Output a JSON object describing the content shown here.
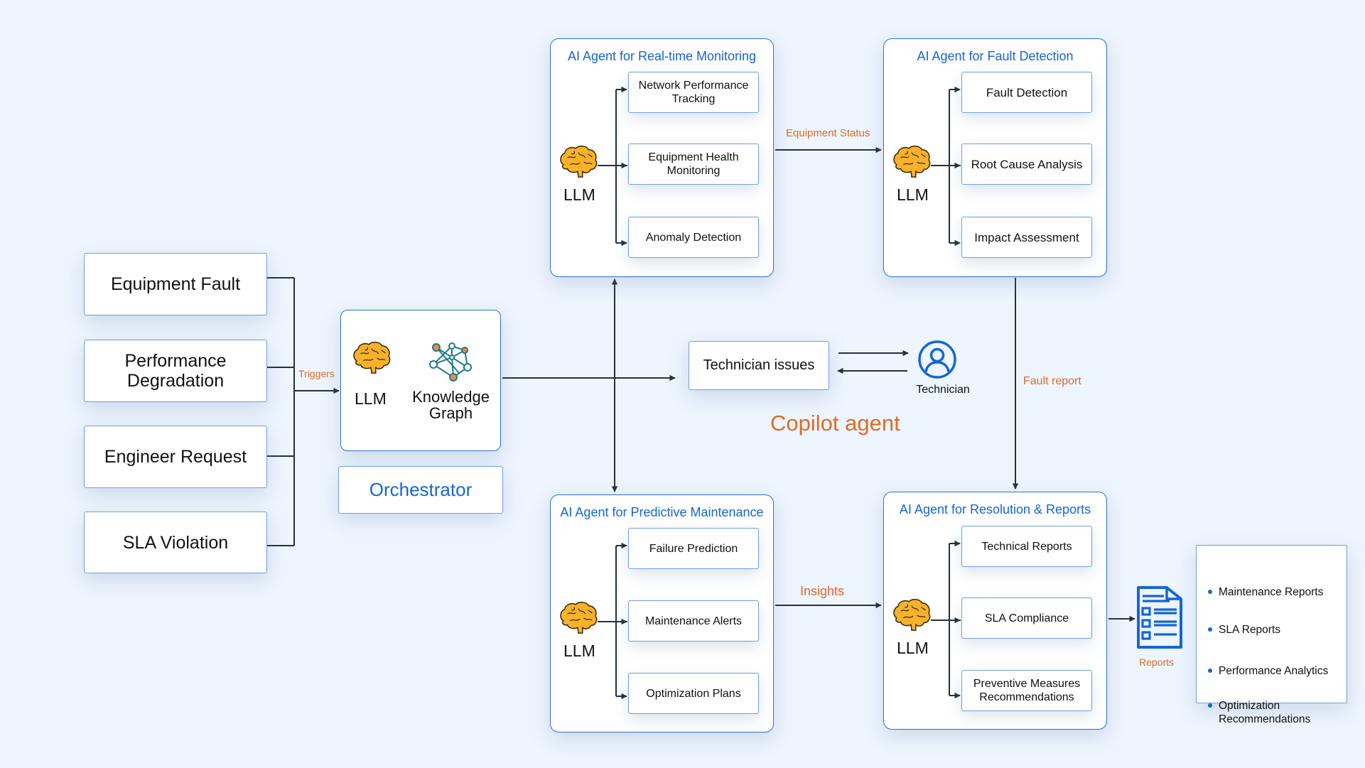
{
  "inputs": [
    {
      "label": "Equipment Fault"
    },
    {
      "label": "Performance\nDegradation"
    },
    {
      "label": "Engineer Request"
    },
    {
      "label": "SLA Violation"
    }
  ],
  "edge_labels": {
    "triggers": "Triggers",
    "equipment_status": "Equipment Status",
    "fault_report": "Fault report",
    "insights": "Insights",
    "reports": "Reports"
  },
  "orchestrator": {
    "llm_label": "LLM",
    "kg_label": "Knowledge\nGraph",
    "title": "Orchestrator"
  },
  "copilot": {
    "issue_box": "Technician issues",
    "technician_label": "Technician",
    "title": "Copilot agent"
  },
  "agents": {
    "monitoring": {
      "title": "AI Agent for Real-time Monitoring",
      "llm_label": "LLM",
      "tasks": [
        "Network Performance\nTracking",
        "Equipment Health\nMonitoring",
        "Anomaly Detection"
      ]
    },
    "fault": {
      "title": "AI Agent for Fault Detection",
      "llm_label": "LLM",
      "tasks": [
        "Fault Detection",
        "Root Cause Analysis",
        "Impact Assessment"
      ]
    },
    "predictive": {
      "title": "AI Agent for Predictive Maintenance",
      "llm_label": "LLM",
      "tasks": [
        "Failure Prediction",
        "Maintenance Alerts",
        "Optimization Plans"
      ]
    },
    "resolution": {
      "title": "AI Agent for Resolution & Reports",
      "llm_label": "LLM",
      "tasks": [
        "Technical Reports",
        "SLA Compliance",
        "Preventive Measures\nRecommendations"
      ]
    }
  },
  "report_outputs": [
    "Maintenance Reports",
    "SLA Reports",
    "Performance Analytics",
    "Optimization\nRecommendations"
  ],
  "icons": {
    "brain": "brain-icon",
    "knowledge_graph": "knowledge-graph-icon",
    "technician": "user-circle-icon",
    "reports": "report-document-icon"
  },
  "colors": {
    "background": "#edf5fe",
    "accent_blue": "#1565d8",
    "accent_orange": "#e06a28",
    "border_blue": "#6f9ee6",
    "arrow": "#26303d",
    "brain": "#f7b12a"
  }
}
